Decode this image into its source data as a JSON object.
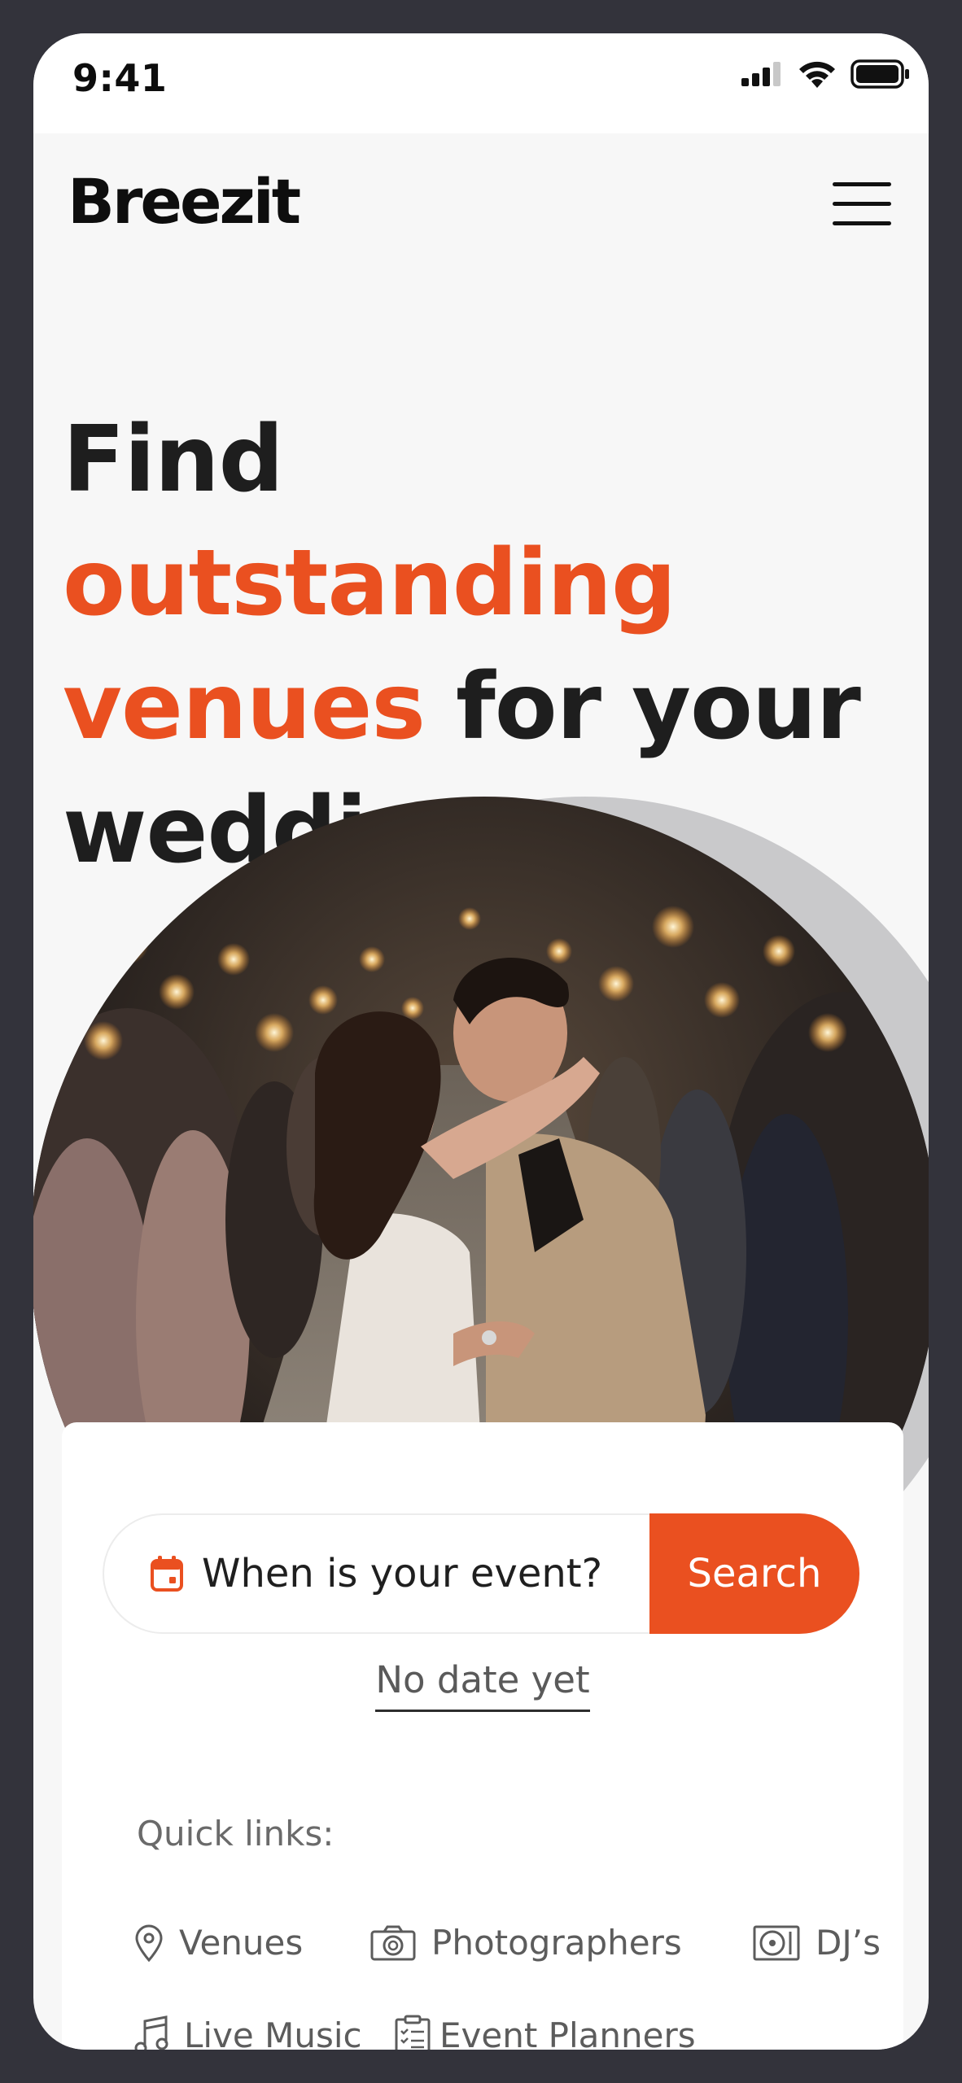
{
  "status_bar": {
    "time": "9:41"
  },
  "header": {
    "logo": "Breezit"
  },
  "hero": {
    "line1_plain": "Find ",
    "line1_accent": "outstanding",
    "line2_accent": "venues",
    "line2_plain": " for your",
    "line3_plain": "wedding"
  },
  "search": {
    "date_placeholder": "When is your event?",
    "button_label": "Search",
    "no_date_link": "No date yet"
  },
  "quick_links": {
    "title": "Quick links:",
    "items": [
      {
        "label": "Venues",
        "icon": "location-pin-icon"
      },
      {
        "label": "Photographers",
        "icon": "camera-icon"
      },
      {
        "label": "DJ’s",
        "icon": "turntable-icon"
      },
      {
        "label": "Live Music",
        "icon": "music-note-icon"
      },
      {
        "label": "Event Planners",
        "icon": "clipboard-icon"
      }
    ]
  },
  "colors": {
    "accent": "#ea5020",
    "text": "#1e1e1e",
    "background": "#f7f7f7"
  }
}
